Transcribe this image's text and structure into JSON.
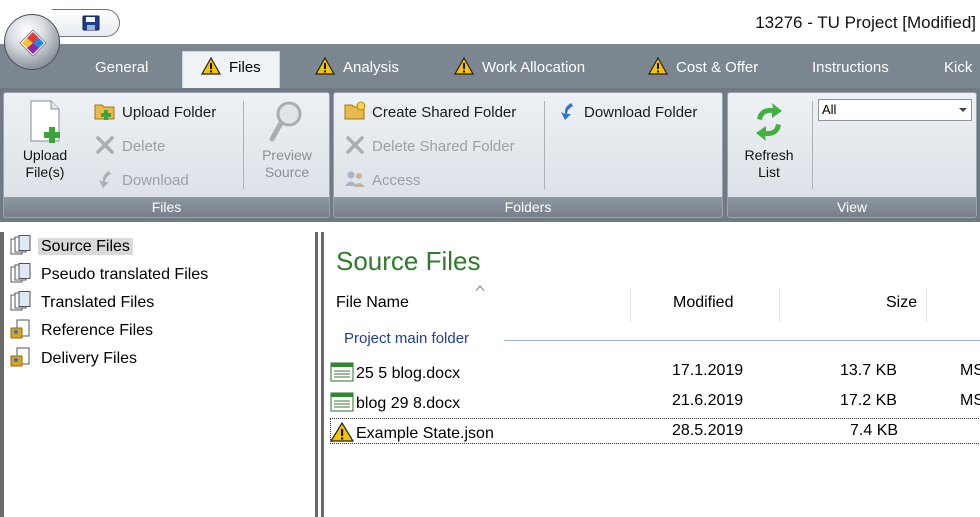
{
  "window": {
    "title": "13276 - TU Project [Modified]"
  },
  "tabs": [
    {
      "label": "General",
      "warning": false,
      "active": false
    },
    {
      "label": "Files",
      "warning": true,
      "active": true
    },
    {
      "label": "Analysis",
      "warning": true,
      "active": false
    },
    {
      "label": "Work Allocation",
      "warning": true,
      "active": false
    },
    {
      "label": "Cost & Offer",
      "warning": true,
      "active": false
    },
    {
      "label": "Instructions",
      "warning": false,
      "active": false
    },
    {
      "label": "Kick",
      "warning": false,
      "active": false
    }
  ],
  "ribbon": {
    "files": {
      "label": "Files",
      "upload_files": "Upload File(s)",
      "upload_folder": "Upload Folder",
      "delete": "Delete",
      "download": "Download",
      "preview_source": "Preview Source"
    },
    "folders": {
      "label": "Folders",
      "create_shared": "Create Shared Folder",
      "delete_shared": "Delete Shared Folder",
      "access": "Access",
      "download_folder": "Download Folder"
    },
    "view": {
      "label": "View",
      "refresh_list": "Refresh List",
      "select_value": "All"
    }
  },
  "tree": {
    "items": [
      {
        "label": "Source Files",
        "selected": true
      },
      {
        "label": "Pseudo translated Files",
        "selected": false
      },
      {
        "label": "Translated Files",
        "selected": false
      },
      {
        "label": "Reference Files",
        "selected": false
      },
      {
        "label": "Delivery Files",
        "selected": false
      }
    ]
  },
  "content": {
    "title": "Source Files",
    "columns": {
      "name": "File Name",
      "modified": "Modified",
      "size": "Size"
    },
    "group": "Project main folder",
    "rows": [
      {
        "icon": "document-icon",
        "name": "25 5 blog.docx",
        "modified": "17.1.2019",
        "size": "13.7 KB",
        "type": "MS"
      },
      {
        "icon": "document-icon",
        "name": "blog 29 8.docx",
        "modified": "21.6.2019",
        "size": "17.2 KB",
        "type": "MS"
      },
      {
        "icon": "warning-icon",
        "name": "Example State.json",
        "modified": "28.5.2019",
        "size": "7.4 KB",
        "type": ""
      }
    ]
  },
  "colors": {
    "ribbon_bg": "#6f7a84",
    "tab_strip": "#7b8690",
    "title_green": "#2f7a2f",
    "group_header_blue": "#1f3e9a",
    "warning_yellow": "#f5c400"
  }
}
